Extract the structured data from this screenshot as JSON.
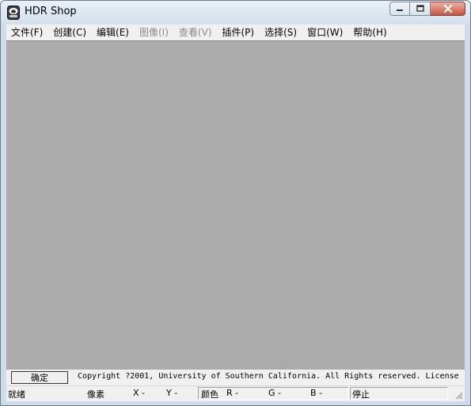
{
  "window": {
    "title": "HDR Shop",
    "controls": [
      "minimize-icon",
      "maximize-icon",
      "close-icon"
    ]
  },
  "menubar": {
    "items": [
      {
        "label": "文件(F)",
        "enabled": true
      },
      {
        "label": "创建(C)",
        "enabled": true
      },
      {
        "label": "编辑(E)",
        "enabled": true
      },
      {
        "label": "图像(I)",
        "enabled": false
      },
      {
        "label": "查看(V)",
        "enabled": false
      },
      {
        "label": "插件(P)",
        "enabled": true
      },
      {
        "label": "选择(S)",
        "enabled": true
      },
      {
        "label": "窗口(W)",
        "enabled": true
      },
      {
        "label": "帮助(H)",
        "enabled": true
      }
    ]
  },
  "client": {
    "background": "#ababab"
  },
  "infobar": {
    "ok_label": "确定",
    "copyright": "Copyright ?2001, University of Southern California.  All Rights reserved.  License"
  },
  "statusbar": {
    "ready": "就绪",
    "pixel": "像素",
    "x": "X -",
    "y": "Y -",
    "color": "颜色",
    "r": "R -",
    "g": "G -",
    "b": "B -",
    "stop": "停止"
  }
}
